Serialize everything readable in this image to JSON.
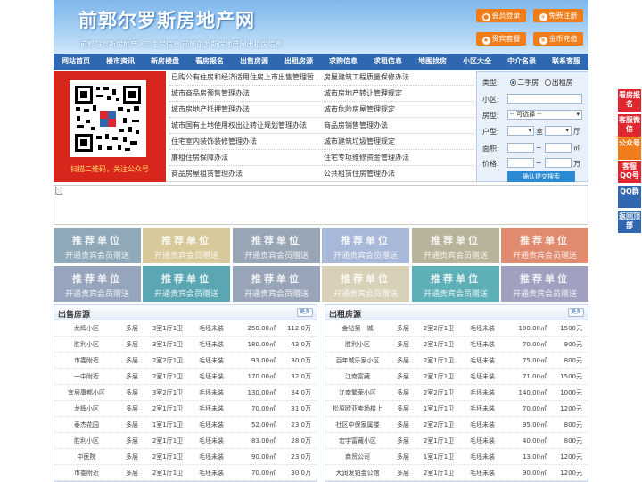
{
  "header": {
    "title": "前郭尔罗斯房地产网",
    "subtitle": "前郭尔罗斯房地产网二手房信息   前郭尔罗斯房地产网出租房信息",
    "buttons": [
      {
        "label": "会员登录",
        "icon": "user-icon"
      },
      {
        "label": "免费注册",
        "icon": "register-icon"
      },
      {
        "label": "贵宾套餐",
        "icon": "vip-icon"
      },
      {
        "label": "金币充值",
        "icon": "coin-icon"
      }
    ]
  },
  "nav": [
    "网站首页",
    "楼市资讯",
    "新房楼盘",
    "看房报名",
    "出售房源",
    "出租房源",
    "求购信息",
    "求租信息",
    "地图找房",
    "小区大全",
    "中介名录",
    "联系客服"
  ],
  "qr": {
    "caption": "扫描二维码，关注公众号"
  },
  "news": [
    [
      "已购公有住房和经济适用住房上市出售管理暂",
      "房屋建筑工程质量保修办法"
    ],
    [
      "城市商品房预售管理办法",
      "城市房地产转让管理规定"
    ],
    [
      "城市房地产抵押管理办法",
      "城市危险房屋管理规定"
    ],
    [
      "城市国有土地使用权出让转让规划管理办法",
      "商品房销售管理办法"
    ],
    [
      "住宅室内装饰装修管理办法",
      "城市建筑垃圾管理规定"
    ],
    [
      "廉租住房保障办法",
      "住宅专项维修资金管理办法"
    ],
    [
      "商品房屋租赁管理办法",
      "公共租赁住房管理办法"
    ]
  ],
  "search": {
    "type_label": "类型:",
    "type_options": [
      "二手房",
      "出租房"
    ],
    "community_label": "小区:",
    "housetype_label": "房型:",
    "housetype_value": "-- 可选择 --",
    "layout_label": "户型:",
    "room_unit": "室",
    "hall_unit": "厅",
    "area_label": "面积:",
    "price_label": "价格:",
    "price_unit": "万",
    "range_sep": "~",
    "submit": "确认提交搜索"
  },
  "recommend": {
    "title": "推荐单位",
    "subtitle": "开通贵宾会员赠送",
    "colors": [
      "#8fa9b8",
      "#d8c99a",
      "#98a5b5",
      "#a8b8d8",
      "#b8b39a",
      "#e08a6f",
      "#96a5bd",
      "#5ba6b3",
      "#98a5b8",
      "#d9d0b8",
      "#5eb0b8",
      "#a0a0c0"
    ]
  },
  "sale": {
    "title": "出售房源",
    "more": "更多",
    "rows": [
      [
        "龙辉小区",
        "多层",
        "3室1厅1卫",
        "毛坯未装",
        "250.00㎡",
        "112.0万"
      ],
      [
        "胜利小区",
        "多层",
        "3室1厅1卫",
        "毛坯未装",
        "180.00㎡",
        "43.0万"
      ],
      [
        "市委附近",
        "多层",
        "2室2厅1卫",
        "毛坯未装",
        "93.00㎡",
        "30.0万"
      ],
      [
        "一中附近",
        "多层",
        "2室1厅1卫",
        "毛坯未装",
        "170.00㎡",
        "32.0万"
      ],
      [
        "宜居康都小区",
        "多层",
        "3室2厅1卫",
        "毛坯未装",
        "130.00㎡",
        "34.0万"
      ],
      [
        "龙辉小区",
        "多层",
        "2室1厅1卫",
        "毛坯未装",
        "70.00㎡",
        "31.0万"
      ],
      [
        "泰杰花园",
        "多层",
        "1室1厅1卫",
        "毛坯未装",
        "52.00㎡",
        "23.0万"
      ],
      [
        "胜利小区",
        "多层",
        "2室1厅1卫",
        "毛坯未装",
        "83.00㎡",
        "28.0万"
      ],
      [
        "中医院",
        "多层",
        "2室1厅1卫",
        "毛坯未装",
        "90.00㎡",
        "23.0万"
      ],
      [
        "市委附近",
        "多层",
        "2室1厅1卫",
        "毛坯未装",
        "70.00㎡",
        "30.0万"
      ]
    ]
  },
  "rent": {
    "title": "出租房源",
    "more": "更多",
    "rows": [
      [
        "金钻第一城",
        "多层",
        "2室2厅1卫",
        "毛坯未装",
        "100.00㎡",
        "1500元"
      ],
      [
        "胜利小区",
        "多层",
        "2室1厅1卫",
        "毛坯未装",
        "70.00㎡",
        "900元"
      ],
      [
        "百年城乐家小区",
        "多层",
        "2室1厅1卫",
        "毛坯未装",
        "75.00㎡",
        "800元"
      ],
      [
        "江南富藏",
        "多层",
        "2室1厅1卫",
        "毛坯未装",
        "71.00㎡",
        "1500元"
      ],
      [
        "江南繁荣小区",
        "多层",
        "2室2厅1卫",
        "毛坯未装",
        "140.00㎡",
        "1000元"
      ],
      [
        "松原欧亚卖场楼上",
        "多层",
        "1室1厅1卫",
        "毛坯未装",
        "70.00㎡",
        "1200元"
      ],
      [
        "社区中保家属楼",
        "多层",
        "2室2厅1卫",
        "毛坯未装",
        "95.00㎡",
        "800元"
      ],
      [
        "宏宇富藏小区",
        "多层",
        "2室1厅1卫",
        "毛坯未装",
        "40.00㎡",
        "800元"
      ],
      [
        "商贸公司",
        "多层",
        "1室1厅1卫",
        "毛坯未装",
        "13.00㎡",
        "1200元"
      ],
      [
        "大润发铂金公馆",
        "多层",
        "2室1厅1卫",
        "毛坯未装",
        "90.00㎡",
        "1200元"
      ]
    ]
  },
  "side": [
    {
      "label": "看房报名",
      "color": "#e0262f"
    },
    {
      "label": "客服微信",
      "color": "#e0262f"
    },
    {
      "label": "公众号",
      "color": "#f07c1a"
    },
    {
      "label": "客服QQ号",
      "color": "#e0262f"
    },
    {
      "label": "QQ群",
      "color": "#2f67b0"
    },
    {
      "label": "返回顶部",
      "color": "#2f67b0"
    }
  ]
}
